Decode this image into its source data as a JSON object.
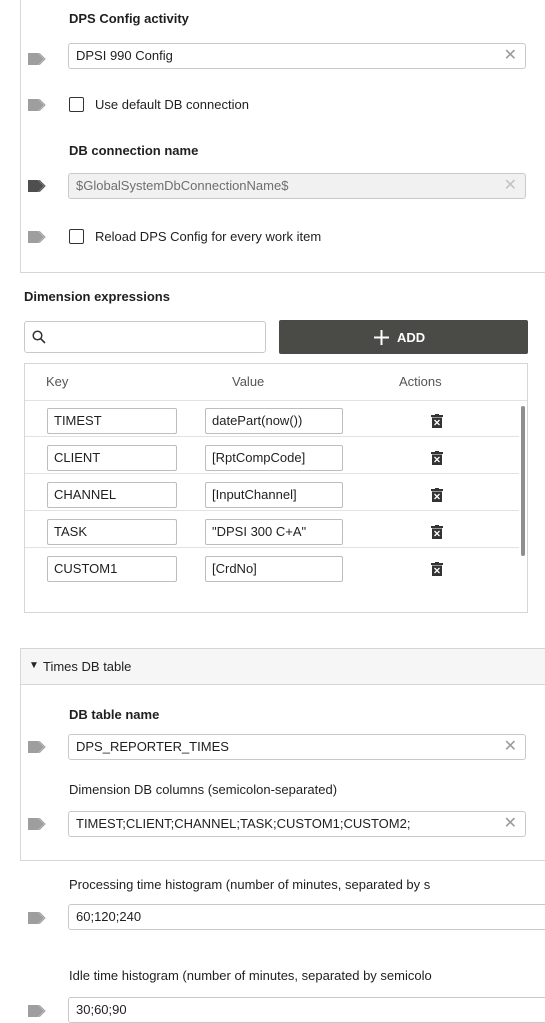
{
  "dps": {
    "config_label": "DPS Config activity",
    "config_value": "DPSI 990 Config",
    "use_default_db_label": "Use default DB connection",
    "db_conn_label": "DB connection name",
    "db_conn_value": "$GlobalSystemDbConnectionName$",
    "reload_label": "Reload DPS Config for every work item"
  },
  "dimensions": {
    "title": "Dimension expressions",
    "search_placeholder": "",
    "add_label": "ADD",
    "columns": {
      "key": "Key",
      "value": "Value",
      "actions": "Actions"
    },
    "rows": [
      {
        "key": "TIMEST",
        "value": "datePart(now())"
      },
      {
        "key": "CLIENT",
        "value": "[RptCompCode]"
      },
      {
        "key": "CHANNEL",
        "value": "[InputChannel]"
      },
      {
        "key": "TASK",
        "value": "\"DPSI 300 C+A\""
      },
      {
        "key": "CUSTOM1",
        "value": "[CrdNo]"
      }
    ]
  },
  "times": {
    "section_title": "Times DB table",
    "table_name_label": "DB table name",
    "table_name_value": "DPS_REPORTER_TIMES",
    "dim_cols_label": "Dimension DB columns (semicolon-separated)",
    "dim_cols_value": "TIMEST;CLIENT;CHANNEL;TASK;CUSTOM1;CUSTOM2;",
    "processing_label": "Processing time histogram (number of minutes, separated by s",
    "processing_value": "60;120;240",
    "idle_label": "Idle time histogram (number of minutes, separated by semicolo",
    "idle_value": "30;60;90"
  },
  "icons": {
    "tag": "tag-icon",
    "clear": "close-icon",
    "search": "search-icon",
    "add": "plus-icon",
    "delete": "trash-icon",
    "collapse": "caret-down-icon"
  },
  "colors": {
    "add_button_bg": "#4a4a47",
    "tag_dark": "#5a5a5a",
    "tag_light": "#9e9e9e"
  }
}
